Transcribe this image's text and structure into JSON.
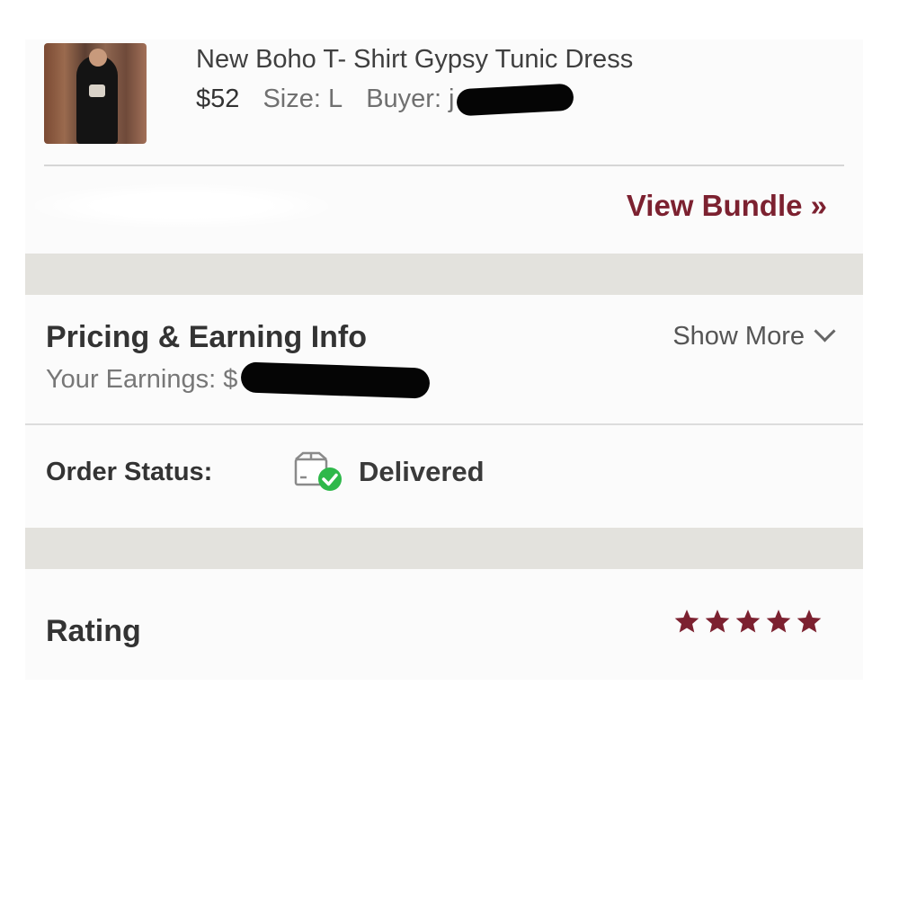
{
  "item": {
    "title": "New Boho T- Shirt Gypsy Tunic Dress",
    "price": "$52",
    "size": "Size: L",
    "buyer_label": "Buyer: j",
    "view_bundle": "View Bundle »"
  },
  "pricing": {
    "heading": "Pricing & Earning Info",
    "earnings_label": "Your Earnings: $",
    "show_more": "Show More"
  },
  "order": {
    "label": "Order Status:",
    "status": "Delivered",
    "status_icon": "delivered-box-icon"
  },
  "rating": {
    "label": "Rating",
    "stars": 5,
    "max_stars": 5,
    "star_color": "#7c2130"
  },
  "colors": {
    "accent": "#7c2130",
    "success": "#2eb84a",
    "separator": "#e3e2dd"
  }
}
